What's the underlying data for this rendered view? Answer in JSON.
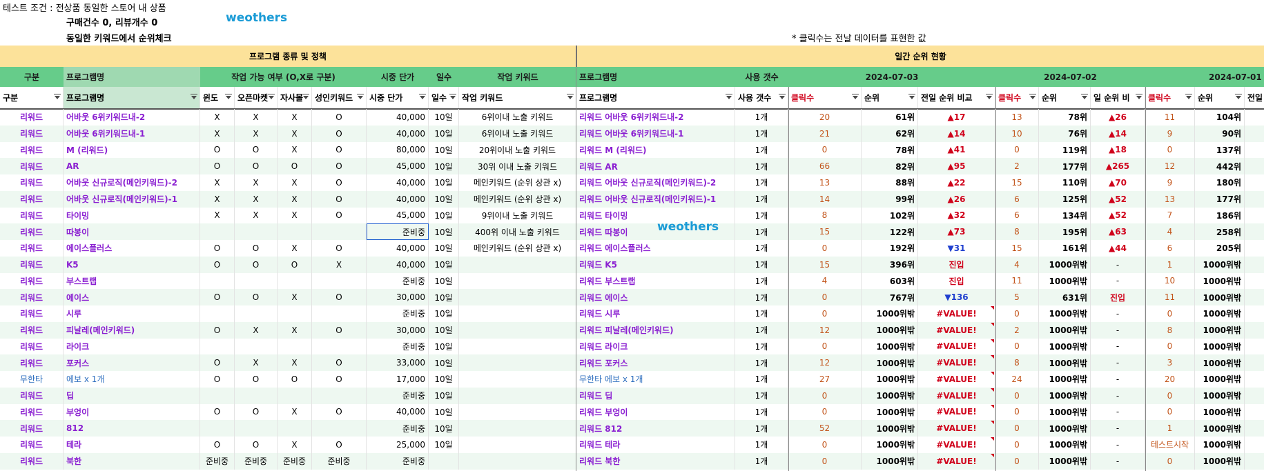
{
  "info": {
    "line1": "테스트 조건 : 전상품 동일한 스토어 내 상품",
    "line2": "구매건수 0, 리뷰개수 0",
    "line3": "동일한 키워드에서 순위체크",
    "note": "* 클릭수는 전날 데이터를 표현한 값",
    "watermark": "weothers"
  },
  "band1": {
    "left": "프로그램 종류 및 정책",
    "right": "일간 순위 현황"
  },
  "band2": {
    "type": "구분",
    "program": "프로그램명",
    "avail": "작업 가능 여부 (O,X로 구분)",
    "price": "시중 단가",
    "days": "일수",
    "keyword": "작업 키워드",
    "program2": "프로그램명",
    "count": "사용 갯수",
    "date1": "2024-07-03",
    "date2": "2024-07-02",
    "date3": "2024-07-01"
  },
  "header": {
    "type": "구분",
    "program": "프로그램명",
    "windo": "윈도",
    "openmarket": "오픈마켓",
    "jasamol": "자사몰",
    "adult": "성인키워드",
    "price": "시중 단가",
    "days": "일수",
    "keyword": "작업 키워드",
    "program2": "프로그램명",
    "count": "사용 갯수",
    "d1_clicks": "클릭수",
    "d1_rank": "순위",
    "d1_cmp": "전일 순위 비교",
    "d2_clicks": "클릭수",
    "d2_rank": "순위",
    "d2_cmp": "일 순위 비",
    "d3_clicks": "클릭수",
    "d3_rank": "순위",
    "d3_cmp": "전일"
  },
  "rows": [
    {
      "type": "리워드",
      "program": "어바웃 6위키워드내-2",
      "w": "X",
      "o": "X",
      "j": "X",
      "a": "O",
      "price": "40,000",
      "days": "10일",
      "kw": "6위이내 노출 키워드",
      "p2": "리워드 어바웃 6위키워드내-2",
      "cnt": "1개",
      "c1": "20",
      "r1": "61위",
      "m1": "▲17",
      "c2": "13",
      "r2": "78위",
      "m2": "▲26",
      "c3": "11",
      "r3": "104위"
    },
    {
      "type": "리워드",
      "program": "어바웃 6위키워드내-1",
      "w": "X",
      "o": "X",
      "j": "X",
      "a": "O",
      "price": "40,000",
      "days": "10일",
      "kw": "6위이내 노출 키워드",
      "p2": "리워드 어바웃 6위키워드내-1",
      "cnt": "1개",
      "c1": "21",
      "r1": "62위",
      "m1": "▲14",
      "c2": "10",
      "r2": "76위",
      "m2": "▲14",
      "c3": "9",
      "r3": "90위"
    },
    {
      "type": "리워드",
      "program": "M (리워드)",
      "w": "O",
      "o": "O",
      "j": "X",
      "a": "O",
      "price": "80,000",
      "days": "10일",
      "kw": "20위이내 노출 키워드",
      "p2": "리워드 M (리워드)",
      "cnt": "1개",
      "c1": "0",
      "r1": "78위",
      "m1": "▲41",
      "c2": "0",
      "r2": "119위",
      "m2": "▲18",
      "c3": "0",
      "r3": "137위"
    },
    {
      "type": "리워드",
      "program": "AR",
      "w": "O",
      "o": "O",
      "j": "O",
      "a": "O",
      "price": "45,000",
      "days": "10일",
      "kw": "30위 이내 노출 키워드",
      "p2": "리워드 AR",
      "cnt": "1개",
      "c1": "66",
      "r1": "82위",
      "m1": "▲95",
      "c2": "2",
      "r2": "177위",
      "m2": "▲265",
      "c3": "12",
      "r3": "442위"
    },
    {
      "type": "리워드",
      "program": "어바웃 신규로직(메인키워드)-2",
      "w": "X",
      "o": "X",
      "j": "X",
      "a": "O",
      "price": "40,000",
      "days": "10일",
      "kw": "메인키워드 (순위 상관 x)",
      "p2": "리워드 어바웃 신규로직(메인키워드)-2",
      "cnt": "1개",
      "c1": "13",
      "r1": "88위",
      "m1": "▲22",
      "c2": "15",
      "r2": "110위",
      "m2": "▲70",
      "c3": "9",
      "r3": "180위"
    },
    {
      "type": "리워드",
      "program": "어바웃 신규로직(메인키워드)-1",
      "w": "X",
      "o": "X",
      "j": "X",
      "a": "O",
      "price": "40,000",
      "days": "10일",
      "kw": "메인키워드 (순위 상관 x)",
      "p2": "리워드 어바웃 신규로직(메인키워드)-1",
      "cnt": "1개",
      "c1": "14",
      "r1": "99위",
      "m1": "▲26",
      "c2": "6",
      "r2": "125위",
      "m2": "▲52",
      "c3": "13",
      "r3": "177위"
    },
    {
      "type": "리워드",
      "program": "타이밍",
      "w": "X",
      "o": "X",
      "j": "X",
      "a": "O",
      "price": "45,000",
      "days": "10일",
      "kw": "9위이내 노출 키워드",
      "p2": "리워드 타이밍",
      "cnt": "1개",
      "c1": "8",
      "r1": "102위",
      "m1": "▲32",
      "c2": "6",
      "r2": "134위",
      "m2": "▲52",
      "c3": "7",
      "r3": "186위"
    },
    {
      "type": "리워드",
      "program": "따봉이",
      "w": "",
      "o": "",
      "j": "",
      "a": "",
      "price": "준비중",
      "days": "10일",
      "kw": "400위 이내 노출 키워드",
      "p2": "리워드 따봉이",
      "cnt": "1개",
      "c1": "15",
      "r1": "122위",
      "m1": "▲73",
      "c2": "8",
      "r2": "195위",
      "m2": "▲63",
      "c3": "4",
      "r3": "258위"
    },
    {
      "type": "리워드",
      "program": "에이스플러스",
      "w": "O",
      "o": "O",
      "j": "X",
      "a": "O",
      "price": "40,000",
      "days": "10일",
      "kw": "메인키워드 (순위 상관 x)",
      "p2": "리워드 에이스플러스",
      "cnt": "1개",
      "c1": "0",
      "r1": "192위",
      "m1": "▼31",
      "c2": "15",
      "r2": "161위",
      "m2": "▲44",
      "c3": "6",
      "r3": "205위"
    },
    {
      "type": "리워드",
      "program": "K5",
      "w": "O",
      "o": "O",
      "j": "O",
      "a": "X",
      "price": "40,000",
      "days": "10일",
      "kw": "",
      "p2": "리워드 K5",
      "cnt": "1개",
      "c1": "15",
      "r1": "396위",
      "m1": "진입",
      "c2": "4",
      "r2": "1000위밖",
      "m2": "-",
      "c3": "1",
      "r3": "1000위밖"
    },
    {
      "type": "리워드",
      "program": "부스트랩",
      "w": "",
      "o": "",
      "j": "",
      "a": "",
      "price": "준비중",
      "days": "10일",
      "kw": "",
      "p2": "리워드 부스트랩",
      "cnt": "1개",
      "c1": "4",
      "r1": "603위",
      "m1": "진입",
      "c2": "11",
      "r2": "1000위밖",
      "m2": "-",
      "c3": "10",
      "r3": "1000위밖"
    },
    {
      "type": "리워드",
      "program": "에이스",
      "w": "O",
      "o": "O",
      "j": "X",
      "a": "O",
      "price": "30,000",
      "days": "10일",
      "kw": "",
      "p2": "리워드 에이스",
      "cnt": "1개",
      "c1": "0",
      "r1": "767위",
      "m1": "▼136",
      "c2": "5",
      "r2": "631위",
      "m2": "진입",
      "c3": "11",
      "r3": "1000위밖"
    },
    {
      "type": "리워드",
      "program": "시루",
      "w": "",
      "o": "",
      "j": "",
      "a": "",
      "price": "준비중",
      "days": "10일",
      "kw": "",
      "p2": "리워드 시루",
      "cnt": "1개",
      "c1": "0",
      "r1": "1000위밖",
      "m1": "#VALUE!",
      "c2": "0",
      "r2": "1000위밖",
      "m2": "-",
      "c3": "0",
      "r3": "1000위밖"
    },
    {
      "type": "리워드",
      "program": "피날레(메인키워드)",
      "w": "O",
      "o": "X",
      "j": "X",
      "a": "O",
      "price": "30,000",
      "days": "10일",
      "kw": "",
      "p2": "리워드 피날레(메인키워드)",
      "cnt": "1개",
      "c1": "12",
      "r1": "1000위밖",
      "m1": "#VALUE!",
      "c2": "2",
      "r2": "1000위밖",
      "m2": "-",
      "c3": "8",
      "r3": "1000위밖"
    },
    {
      "type": "리워드",
      "program": "라이크",
      "w": "",
      "o": "",
      "j": "",
      "a": "",
      "price": "준비중",
      "days": "10일",
      "kw": "",
      "p2": "리워드 라이크",
      "cnt": "1개",
      "c1": "0",
      "r1": "1000위밖",
      "m1": "#VALUE!",
      "c2": "0",
      "r2": "1000위밖",
      "m2": "-",
      "c3": "0",
      "r3": "1000위밖"
    },
    {
      "type": "리워드",
      "program": "포커스",
      "w": "O",
      "o": "X",
      "j": "X",
      "a": "O",
      "price": "33,000",
      "days": "10일",
      "kw": "",
      "p2": "리워드 포커스",
      "cnt": "1개",
      "c1": "12",
      "r1": "1000위밖",
      "m1": "#VALUE!",
      "c2": "8",
      "r2": "1000위밖",
      "m2": "-",
      "c3": "3",
      "r3": "1000위밖"
    },
    {
      "type": "무한타",
      "program": "에보 x 1개",
      "w": "O",
      "o": "O",
      "j": "O",
      "a": "O",
      "price": "17,000",
      "days": "10일",
      "kw": "",
      "p2": "무한타 에보 x 1개",
      "cnt": "1개",
      "c1": "27",
      "r1": "1000위밖",
      "m1": "#VALUE!",
      "c2": "24",
      "r2": "1000위밖",
      "m2": "-",
      "c3": "20",
      "r3": "1000위밖"
    },
    {
      "type": "리워드",
      "program": "딥",
      "w": "",
      "o": "",
      "j": "",
      "a": "",
      "price": "준비중",
      "days": "10일",
      "kw": "",
      "p2": "리워드 딥",
      "cnt": "1개",
      "c1": "0",
      "r1": "1000위밖",
      "m1": "#VALUE!",
      "c2": "0",
      "r2": "1000위밖",
      "m2": "-",
      "c3": "0",
      "r3": "1000위밖"
    },
    {
      "type": "리워드",
      "program": "부엉이",
      "w": "O",
      "o": "O",
      "j": "X",
      "a": "O",
      "price": "40,000",
      "days": "10일",
      "kw": "",
      "p2": "리워드 부엉이",
      "cnt": "1개",
      "c1": "0",
      "r1": "1000위밖",
      "m1": "#VALUE!",
      "c2": "0",
      "r2": "1000위밖",
      "m2": "-",
      "c3": "0",
      "r3": "1000위밖"
    },
    {
      "type": "리워드",
      "program": "812",
      "w": "",
      "o": "",
      "j": "",
      "a": "",
      "price": "준비중",
      "days": "10일",
      "kw": "",
      "p2": "리워드 812",
      "cnt": "1개",
      "c1": "52",
      "r1": "1000위밖",
      "m1": "#VALUE!",
      "c2": "0",
      "r2": "1000위밖",
      "m2": "-",
      "c3": "1",
      "r3": "1000위밖"
    },
    {
      "type": "리워드",
      "program": "테라",
      "w": "O",
      "o": "O",
      "j": "X",
      "a": "O",
      "price": "25,000",
      "days": "10일",
      "kw": "",
      "p2": "리워드 테라",
      "cnt": "1개",
      "c1": "0",
      "r1": "1000위밖",
      "m1": "#VALUE!",
      "c2": "0",
      "r2": "1000위밖",
      "m2": "-",
      "c3": "테스트시작",
      "r3": "1000위밖"
    },
    {
      "type": "리워드",
      "program": "북한",
      "w": "준비중",
      "o": "준비중",
      "j": "준비중",
      "a": "준비중",
      "price": "준비중",
      "days": "",
      "kw": "",
      "p2": "리워드 북한",
      "cnt": "1개",
      "c1": "0",
      "r1": "1000위밖",
      "m1": "#VALUE!",
      "c2": "0",
      "r2": "1000위밖",
      "m2": "-",
      "c3": "0",
      "r3": "1000위밖"
    }
  ]
}
